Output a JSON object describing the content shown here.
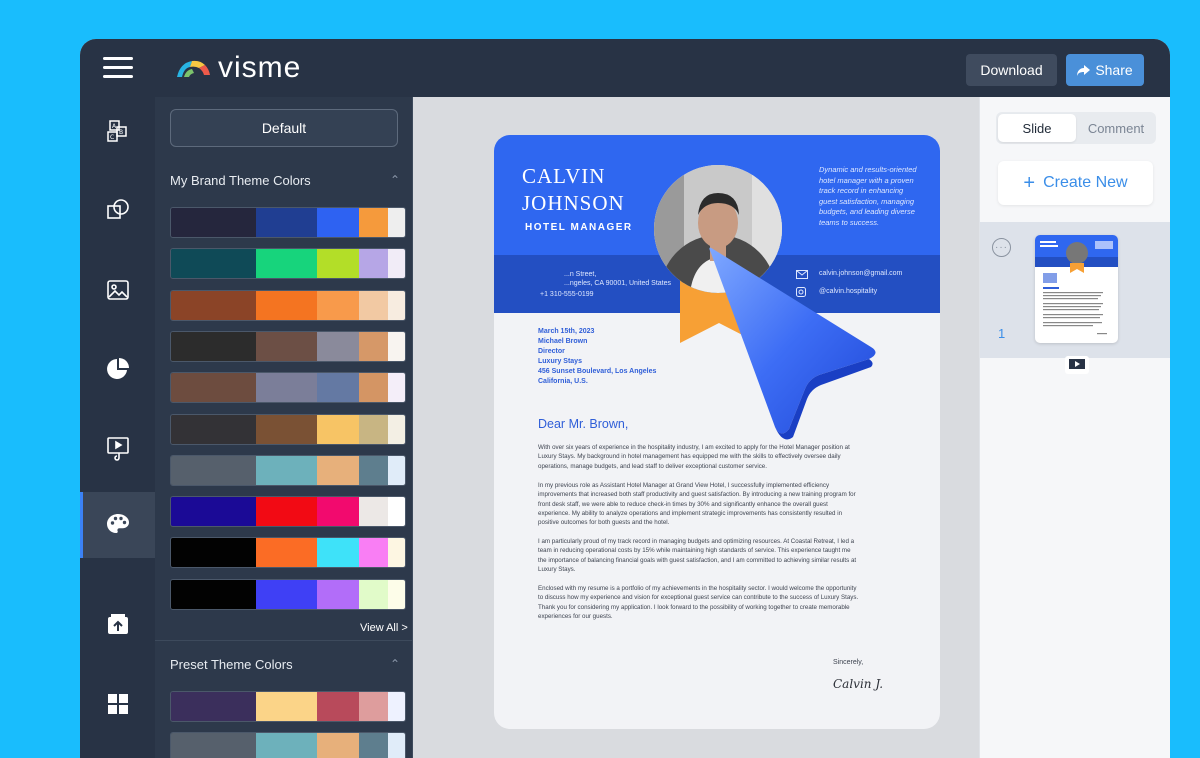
{
  "app": {
    "logo_text": "visme",
    "download_label": "Download",
    "share_label": "Share"
  },
  "rail": {
    "items": [
      "text-blocks-icon",
      "shapes-icon",
      "image-icon",
      "chart-pie-icon",
      "media-icon",
      "palette-icon",
      "upload-icon",
      "apps-grid-icon"
    ],
    "active": "palette-icon"
  },
  "panel": {
    "default_label": "Default",
    "brand_title": "My Brand Theme Colors",
    "view_all": "View All >",
    "preset_title": "Preset Theme Colors",
    "brand_palettes": [
      [
        "#25263d",
        "#203e92",
        "#2e62f2",
        "#f59a3c",
        "#eeeeee"
      ],
      [
        "#0f4a57",
        "#17d47c",
        "#b3de28",
        "#b6a6e6",
        "#f1ecf7"
      ],
      [
        "#8b4427",
        "#f47421",
        "#f89a4b",
        "#f2c9a3",
        "#f7ece0"
      ],
      [
        "#2c2c2c",
        "#6c4f45",
        "#8a8a9b",
        "#d69868",
        "#f8f4f0"
      ],
      [
        "#6d4c3f",
        "#7b7e99",
        "#6479a3",
        "#d49564",
        "#f4eef9"
      ],
      [
        "#333236",
        "#7a5134",
        "#f7c465",
        "#c8b583",
        "#f3efe4"
      ],
      [
        "#56606c",
        "#6db1bb",
        "#e7b07b",
        "#5e7e8e",
        "#e0ecf9"
      ],
      [
        "#1b0a96",
        "#f20a14",
        "#f20a6e",
        "#ece8e6",
        "#ffffff"
      ],
      [
        "#020202",
        "#fb6c25",
        "#3ee2f9",
        "#f97ef4",
        "#fdf6e2"
      ],
      [
        "#020202",
        "#3f40f5",
        "#b26df9",
        "#e1fbc9",
        "#fdfde9"
      ]
    ],
    "preset_palettes": [
      [
        "#3b2f5c",
        "#fbd488",
        "#b84a5b",
        "#de9d9d",
        "#eef2ff"
      ],
      [
        "#56606c",
        "#6db1bb",
        "#e7b07b",
        "#5e7e8e",
        "#e0ecf9"
      ]
    ]
  },
  "document": {
    "first_name": "CALVIN",
    "last_name": "JOHNSON",
    "role": "HOTEL MANAGER",
    "summary": "Dynamic and results-oriented hotel manager with a proven track record in enhancing guest satisfaction, managing budgets, and leading diverse teams to success.",
    "address_line1": "...n Street,",
    "address_line2": "...ngeles, CA 90001, United States",
    "phone": "+1 310-555-0199",
    "email": "calvin.johnson@gmail.com",
    "social": "@calvin.hospitality",
    "date": "March 15th, 2023",
    "recipient": "Michael Brown",
    "recipient_title": "Director",
    "company": "Luxury Stays",
    "street": "456 Sunset Boulevard, Los Angeles",
    "state": "California, U.S.",
    "greeting": "Dear Mr. Brown,",
    "paragraphs": [
      "With over six years of experience in the hospitality industry, I am excited to apply for the Hotel Manager position at Luxury Stays. My background in hotel management has equipped me with the skills to effectively oversee daily operations, manage budgets, and lead staff to deliver exceptional customer service.",
      "In my previous role as Assistant Hotel Manager at Grand View Hotel, I successfully implemented efficiency improvements that increased both staff productivity and guest satisfaction. By introducing a new training program for front desk staff, we were able to reduce check-in times by 30% and significantly enhance the overall guest experience. My ability to analyze operations and implement strategic improvements has consistently resulted in positive outcomes for both guests and the hotel.",
      "I am particularly proud of my track record in managing budgets and optimizing resources. At Coastal Retreat, I led a team in reducing operational costs by 15% while maintaining high standards of service. This experience taught me the importance of balancing financial goals with guest satisfaction, and I am committed to achieving similar results at Luxury Stays.",
      "Enclosed with my resume is a portfolio of my achievements in the hospitality sector. I would welcome the opportunity to discuss how my experience and vision for exceptional guest service can contribute to the success of Luxury Stays. Thank you for considering my application. I look forward to the possibility of working together to create memorable experiences for our guests."
    ],
    "closing": "Sincerely,",
    "signature": "Calvin J."
  },
  "right_panel": {
    "tab_slide": "Slide",
    "tab_comment": "Comment",
    "create_new": "Create New",
    "slide_number": "1"
  },
  "colors": {
    "brand_blue": "#2f67f0",
    "band_blue": "#234fc2",
    "ribbon_orange": "#f7a035",
    "accent": "#3b8ee8"
  }
}
